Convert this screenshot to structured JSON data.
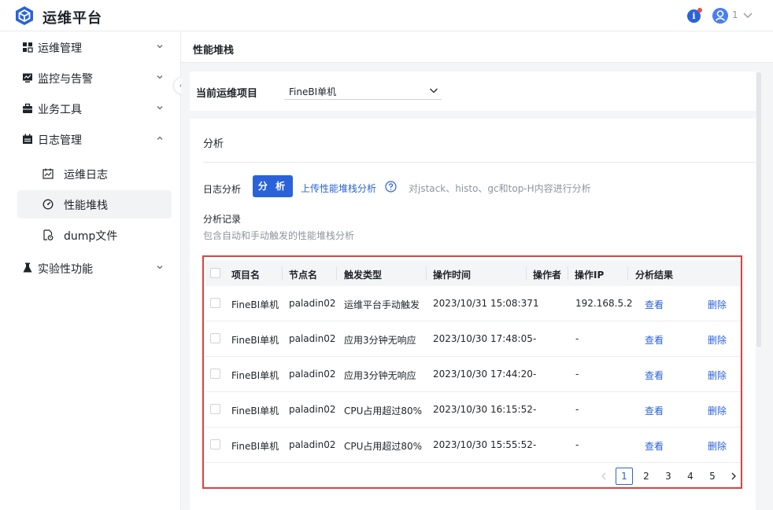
{
  "app": {
    "title": "运维平台"
  },
  "header": {
    "user_name": "1"
  },
  "sidebar": {
    "items": [
      {
        "label": "运维管理",
        "icon": "grid-icon"
      },
      {
        "label": "监控与告警",
        "icon": "monitor-icon"
      },
      {
        "label": "业务工具",
        "icon": "toolbox-icon"
      },
      {
        "label": "日志管理",
        "icon": "calendar-icon"
      },
      {
        "label": "实验性功能",
        "icon": "flask-icon"
      }
    ],
    "subitems": [
      {
        "label": "运维日志",
        "icon": "log-chart-icon"
      },
      {
        "label": "性能堆栈",
        "icon": "gauge-icon"
      },
      {
        "label": "dump文件",
        "icon": "dump-file-icon"
      }
    ]
  },
  "page": {
    "title": "性能堆栈",
    "project_label": "当前运维项目",
    "project_value": "FineBI单机"
  },
  "analysis": {
    "title": "分析",
    "log_label": "日志分析",
    "analyze_button": "分 析",
    "upload_link": "上传性能堆栈分析",
    "hint": "对jstack、histo、gc和top-H内容进行分析",
    "records_title": "分析记录",
    "records_subtitle": "包含自动和手动触发的性能堆栈分析"
  },
  "table": {
    "columns": [
      "项目名",
      "节点名",
      "触发类型",
      "操作时间",
      "操作者",
      "操作IP",
      "分析结果"
    ],
    "view_label": "查看",
    "delete_label": "删除",
    "rows": [
      {
        "project": "FineBI单机",
        "node": "paladin02",
        "trigger": "运维平台手动触发",
        "time": "2023/10/31 15:08:37",
        "operator": "1",
        "ip": "192.168.5.2"
      },
      {
        "project": "FineBI单机",
        "node": "paladin02",
        "trigger": "应用3分钟无响应",
        "time": "2023/10/30 17:48:05",
        "operator": "-",
        "ip": "-"
      },
      {
        "project": "FineBI单机",
        "node": "paladin02",
        "trigger": "应用3分钟无响应",
        "time": "2023/10/30 17:44:20",
        "operator": "-",
        "ip": "-"
      },
      {
        "project": "FineBI单机",
        "node": "paladin02",
        "trigger": "CPU占用超过80%",
        "time": "2023/10/30 16:15:52",
        "operator": "-",
        "ip": "-"
      },
      {
        "project": "FineBI单机",
        "node": "paladin02",
        "trigger": "CPU占用超过80%",
        "time": "2023/10/30 15:55:52",
        "operator": "-",
        "ip": "-"
      }
    ]
  },
  "pagination": {
    "pages": [
      "1",
      "2",
      "3",
      "4",
      "5"
    ],
    "current": "1"
  },
  "colors": {
    "accent": "#2a63d9",
    "highlight_border": "#e04040"
  }
}
